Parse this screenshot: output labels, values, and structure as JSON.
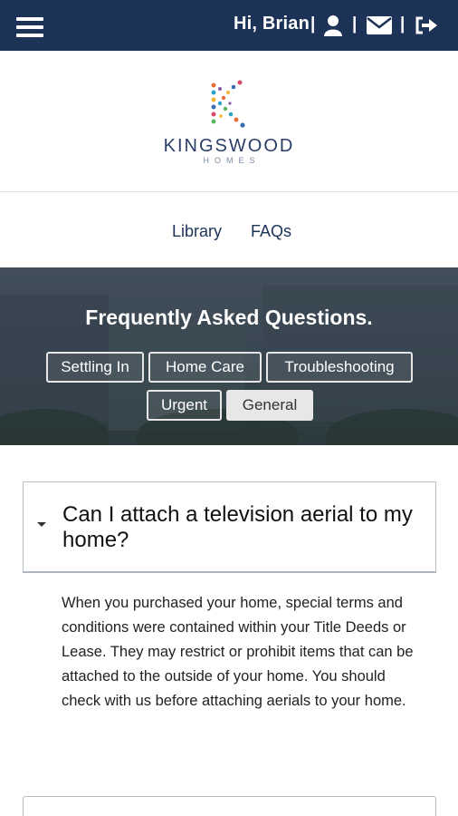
{
  "header": {
    "greeting": "Hi, Brian",
    "separator": "|",
    "icons": [
      "menu-icon",
      "user-icon",
      "mail-icon",
      "logout-icon"
    ]
  },
  "brand": {
    "name": "KINGSWOOD",
    "sub": "HOMES"
  },
  "nav": {
    "items": [
      "Library",
      "FAQs"
    ]
  },
  "hero": {
    "title": "Frequently Asked Questions.",
    "categories": [
      "Settling In",
      "Home Care",
      "Troubleshooting",
      "Urgent",
      "General"
    ],
    "active_category": "General"
  },
  "faq": {
    "question": "Can I attach a television aerial to my home?",
    "answer": "When you purchased your home, special terms and conditions were contained within your Title Deeds or Lease.  They may restrict or prohibit items that can be attached to the outside of your home.  You should check with us before attaching aerials to your home."
  },
  "colors": {
    "header_bg": "#1c3257",
    "brand_text": "#2a3d66",
    "nav_text": "#1c3257",
    "active_pill_bg": "#e7e7e7"
  }
}
